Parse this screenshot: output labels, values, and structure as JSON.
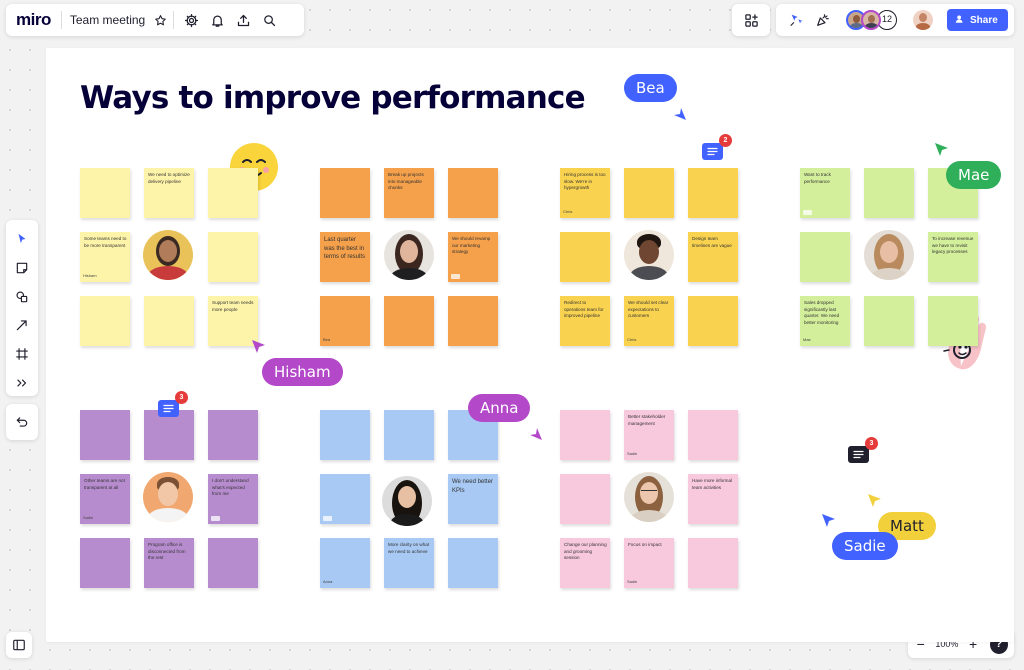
{
  "app": {
    "logo": "miro",
    "board_name": "Team meeting"
  },
  "topbar": {
    "icons": [
      "star-icon",
      "gear-icon",
      "bell-icon",
      "upload-icon",
      "search-icon"
    ],
    "collaborator_count": "12",
    "share_label": "Share"
  },
  "board": {
    "title": "Ways to improve performance"
  },
  "zoom": {
    "value": "100%",
    "minus": "−",
    "plus": "+",
    "help": "?"
  },
  "colors": {
    "accent": "#4262ff",
    "yellow_light": "#fef4a9",
    "orange": "#f5a04a",
    "yellow": "#f9d24f",
    "green": "#d3ef9b",
    "purple": "#b78ccf",
    "blue": "#a8c9f3",
    "pink": "#f8c9dc"
  },
  "clusters": [
    {
      "id": "c1",
      "stickies": [
        {
          "text": ""
        },
        {
          "text": "We need to optimize delivery pipeline"
        },
        {
          "text": ""
        },
        {
          "text": "Some teams need to be more transparent",
          "author": "Hisham"
        },
        {
          "text": ""
        },
        {
          "text": ""
        },
        {
          "text": ""
        },
        {
          "text": "Support team needs more people"
        }
      ]
    },
    {
      "id": "c2",
      "stickies": [
        {
          "text": ""
        },
        {
          "text": "Break up projects into manageable chunks"
        },
        {
          "text": ""
        },
        {
          "text": "Last quarter was the best in terms of results",
          "big": true
        },
        {
          "text": "We should revamp our marketing strategy",
          "tag": true
        },
        {
          "text": "",
          "author": "Bea"
        },
        {
          "text": ""
        },
        {
          "text": ""
        }
      ]
    },
    {
      "id": "c3",
      "stickies": [
        {
          "text": "Hiring process is too slow. We're in hypergrowth",
          "author": "Chris"
        },
        {
          "text": ""
        },
        {
          "text": ""
        },
        {
          "text": ""
        },
        {
          "text": "Design team timelines are vague"
        },
        {
          "text": "Redirect to operations team for improved pipeline"
        },
        {
          "text": "We should set clear expectations to customers",
          "author": "Chris"
        },
        {
          "text": ""
        }
      ]
    },
    {
      "id": "c4",
      "stickies": [
        {
          "text": "Want to track performance",
          "tag": true
        },
        {
          "text": ""
        },
        {
          "text": ""
        },
        {
          "text": ""
        },
        {
          "text": "To increase revenue we have to revisit legacy processes"
        },
        {
          "text": "Sales dropped significantly last quarter. We need better monitoring",
          "author": "Mae"
        },
        {
          "text": ""
        },
        {
          "text": ""
        }
      ]
    },
    {
      "id": "c5",
      "stickies": [
        {
          "text": ""
        },
        {
          "text": ""
        },
        {
          "text": ""
        },
        {
          "text": "Other teams are not transparent at all",
          "author": "Sadie"
        },
        {
          "text": "I don't understand what's expected from me",
          "tag": true
        },
        {
          "text": ""
        },
        {
          "text": "Program office is disconnected from the rest"
        },
        {
          "text": ""
        }
      ]
    },
    {
      "id": "c6",
      "stickies": [
        {
          "text": ""
        },
        {
          "text": ""
        },
        {
          "text": ""
        },
        {
          "text": "",
          "tag": true
        },
        {
          "text": "We need better KPIs",
          "big": true
        },
        {
          "text": "",
          "author": "Anna"
        },
        {
          "text": "More clarity on what we need to achieve"
        },
        {
          "text": ""
        }
      ]
    },
    {
      "id": "c7",
      "stickies": [
        {
          "text": ""
        },
        {
          "text": "Better stakeholder management",
          "author": "Sadie"
        },
        {
          "text": ""
        },
        {
          "text": ""
        },
        {
          "text": "Have more informal team activities"
        },
        {
          "text": "Change our planning and grooming session"
        },
        {
          "text": "Focus on impact",
          "author": "Sadie"
        },
        {
          "text": ""
        }
      ]
    }
  ],
  "cursors": [
    {
      "name": "Bea",
      "color": "#4262ff"
    },
    {
      "name": "Mae",
      "color": "#2faf5a"
    },
    {
      "name": "Hisham",
      "color": "#b348c9"
    },
    {
      "name": "Anna",
      "color": "#b348c9"
    },
    {
      "name": "Matt",
      "color": "#f2d03c"
    },
    {
      "name": "Sadie",
      "color": "#4262ff"
    }
  ],
  "comments": [
    {
      "count": "2",
      "color": "#4262ff"
    },
    {
      "count": "3",
      "color": "#4262ff"
    },
    {
      "count": "3",
      "color": "#1f1f2e"
    }
  ],
  "left_toolbar": [
    "select-cursor-icon",
    "sticky-note-icon",
    "shapes-icon",
    "arrow-line-icon",
    "frame-icon",
    "more-tools-icon",
    "undo-icon"
  ]
}
